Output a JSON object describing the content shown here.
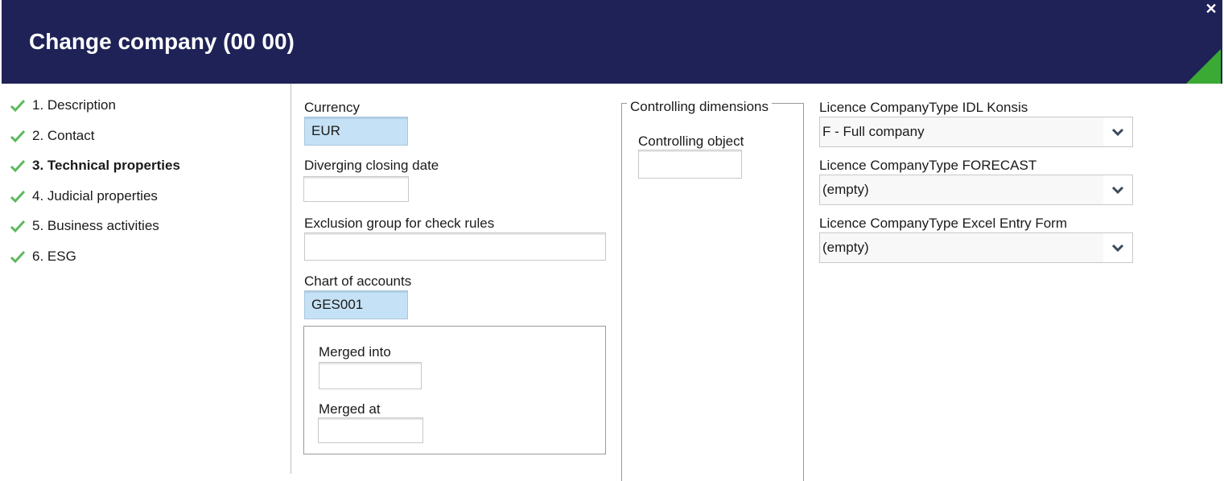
{
  "dialog": {
    "title": "Change company (00 00)",
    "close_label": "✕"
  },
  "nav": {
    "items": [
      {
        "label": "1. Description",
        "active": false
      },
      {
        "label": "2. Contact",
        "active": false
      },
      {
        "label": "3. Technical properties",
        "active": true
      },
      {
        "label": "4. Judicial properties",
        "active": false
      },
      {
        "label": "5. Business activities",
        "active": false
      },
      {
        "label": "6. ESG",
        "active": false
      }
    ]
  },
  "form": {
    "currency": {
      "label": "Currency",
      "value": "EUR"
    },
    "diverging_closing_date": {
      "label": "Diverging closing date",
      "value": ""
    },
    "exclusion_group": {
      "label": "Exclusion group for check rules",
      "value": ""
    },
    "chart_of_accounts": {
      "label": "Chart of accounts",
      "value": "GES001"
    },
    "merged_into": {
      "label": "Merged into",
      "value": ""
    },
    "merged_at": {
      "label": "Merged at",
      "value": ""
    },
    "controlling": {
      "legend": "Controlling dimensions",
      "object_label": "Controlling object",
      "object_value": ""
    },
    "licence_idl": {
      "label": "Licence CompanyType IDL Konsis",
      "value": "F - Full company"
    },
    "licence_forecast": {
      "label": "Licence CompanyType FORECAST",
      "value": "(empty)"
    },
    "licence_excel": {
      "label": "Licence CompanyType Excel Entry Form",
      "value": "(empty)"
    }
  },
  "colors": {
    "header": "#1e2257",
    "accent": "#3aaa35",
    "check": "#5cb85c",
    "filled_input": "#c5e1f5"
  }
}
